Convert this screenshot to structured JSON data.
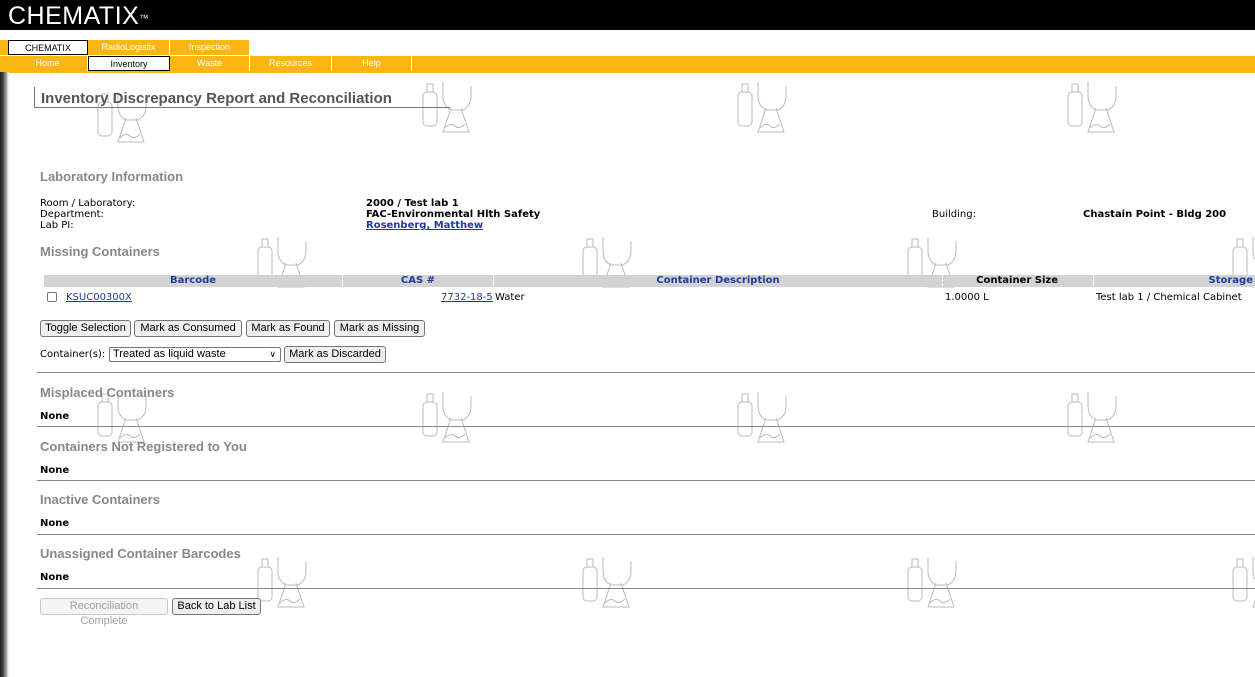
{
  "app": {
    "logo": "CHEMATIX",
    "tm": "™"
  },
  "nav": {
    "row1": [
      "CHEMATIX",
      "RadioLogistix",
      "Inspection"
    ],
    "row2": [
      "Home",
      "Inventory",
      "Waste",
      "Resources",
      "Help"
    ],
    "active_row1": "CHEMATIX",
    "active_row2": "Inventory"
  },
  "page": {
    "title": "Inventory Discrepancy Report and Reconciliation"
  },
  "lab_info": {
    "heading": "Laboratory Information",
    "room_label": "Room / Laboratory:",
    "room_value": "2000 / Test lab 1",
    "department_label": "Department:",
    "department_value": "FAC-Environmental Hlth Safety",
    "pi_label": "Lab PI:",
    "pi_value": "Rosenberg, Matthew",
    "building_label": "Building:",
    "building_value": "Chastain Point - Bldg 200"
  },
  "missing": {
    "heading": "Missing Containers",
    "columns": [
      "Barcode",
      "CAS #",
      "Container Description",
      "Container Size",
      "Storage"
    ],
    "rows": [
      {
        "barcode": "KSUC00300X",
        "cas": "7732-18-5",
        "description": "Water",
        "size": "1.0000 L",
        "storage": "Test lab 1 / Chemical Cabinet"
      }
    ],
    "buttons": {
      "toggle": "Toggle Selection",
      "consumed": "Mark as Consumed",
      "found": "Mark as Found",
      "missing": "Mark as Missing"
    },
    "container_label": "Container(s):",
    "disposal_selected": "Treated as liquid waste",
    "discard_button": "Mark as Discarded"
  },
  "sections": {
    "misplaced": {
      "heading": "Misplaced Containers",
      "value": "None"
    },
    "not_registered": {
      "heading": "Containers Not Registered to You",
      "value": "None"
    },
    "inactive": {
      "heading": "Inactive Containers",
      "value": "None"
    },
    "unassigned": {
      "heading": "Unassigned Container Barcodes",
      "value": "None"
    }
  },
  "footer_buttons": {
    "complete": "Reconciliation Complete",
    "back": "Back to Lab List"
  },
  "colors": {
    "nav": "#fbb616",
    "link": "#1f3aa0",
    "header_bg": "#000000"
  },
  "icons": {
    "watermark": "lab-glassware-icon"
  }
}
